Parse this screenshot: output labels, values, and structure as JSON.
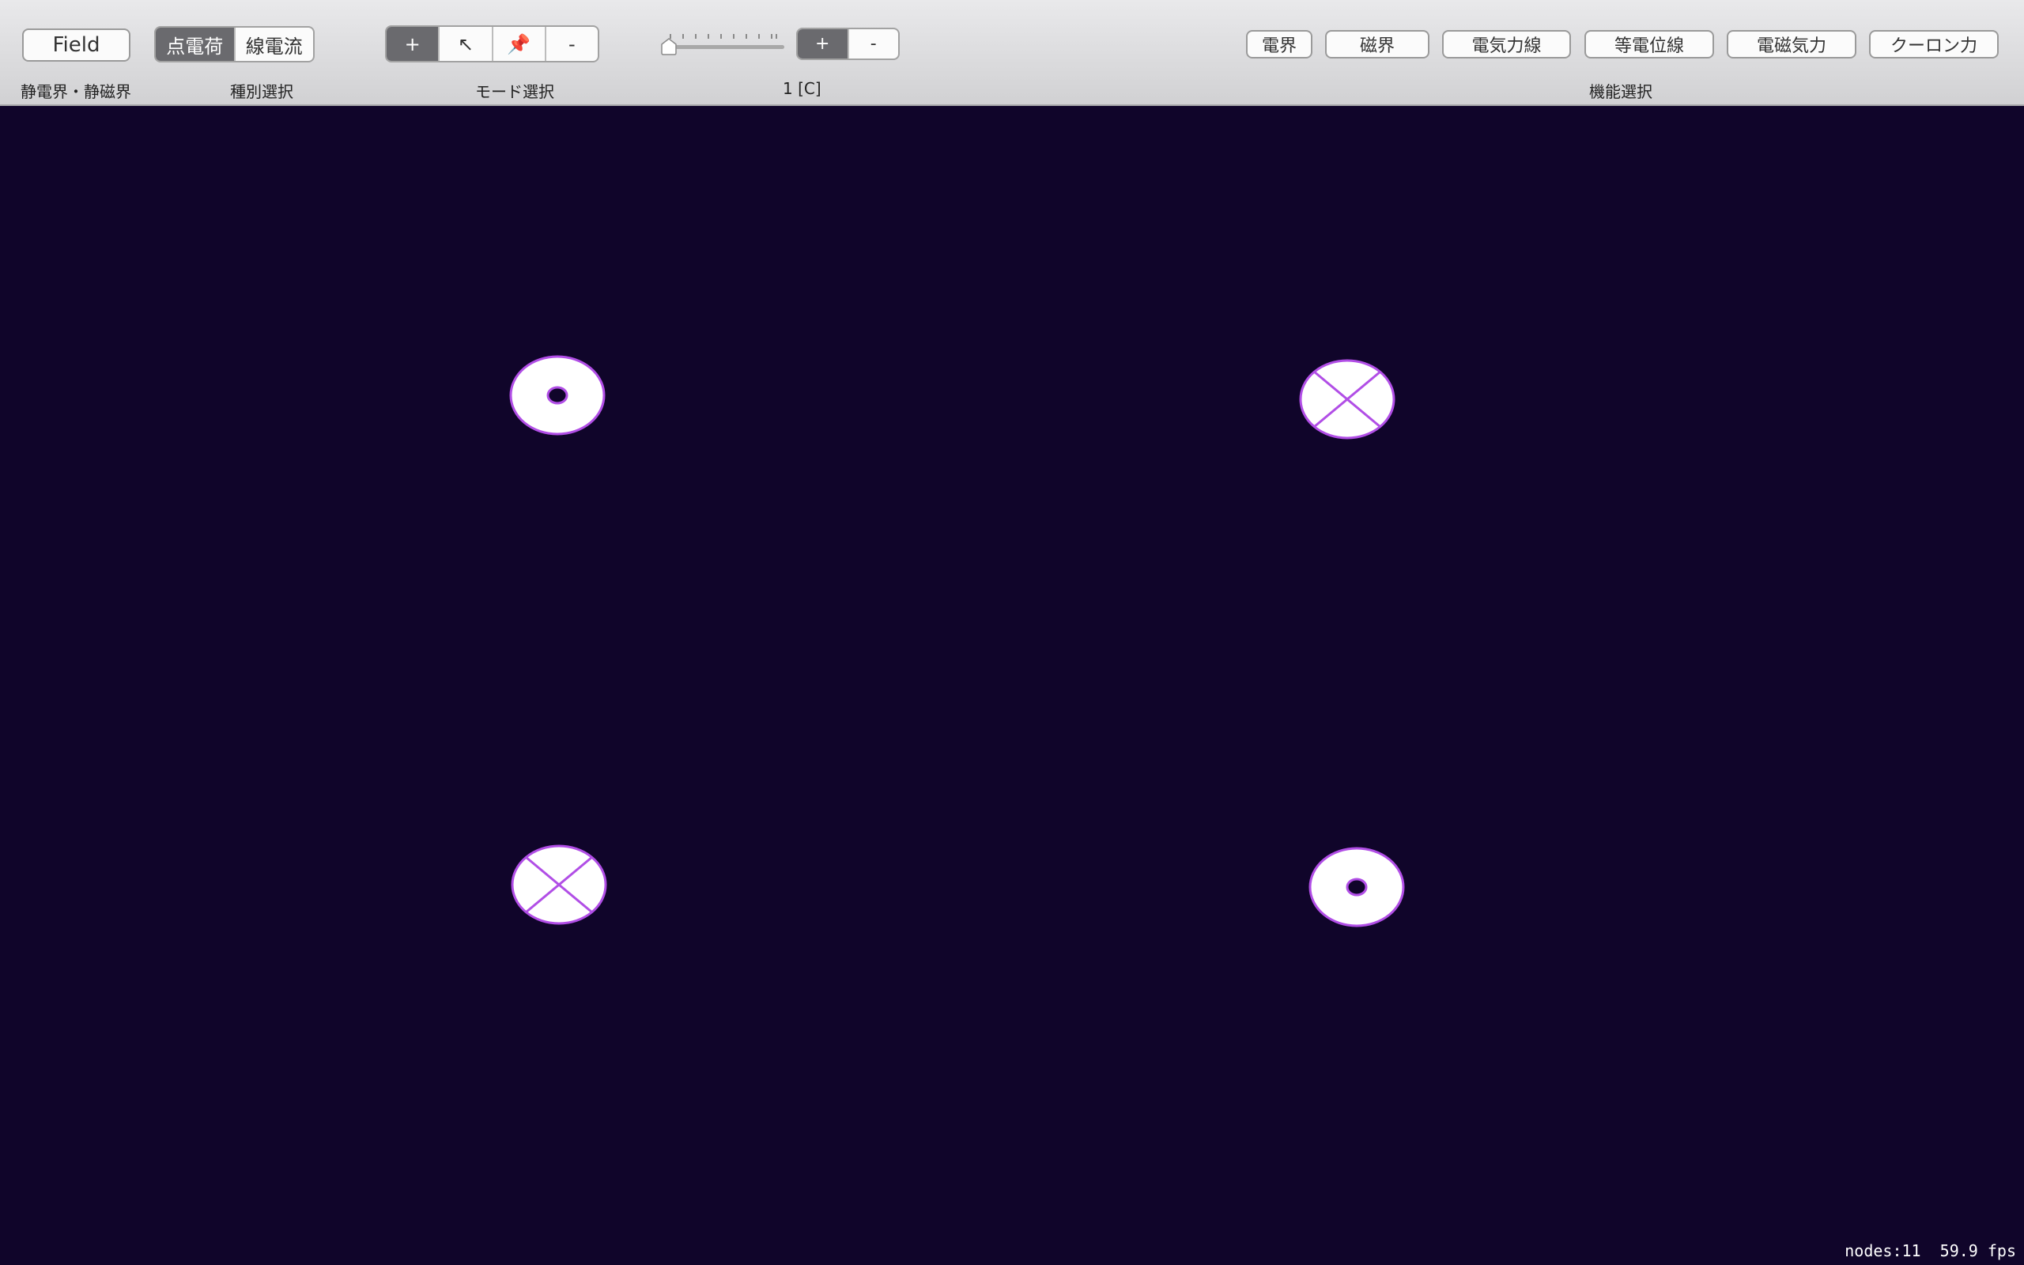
{
  "toolbar": {
    "field_button": "Field",
    "type_options": [
      "点電荷",
      "線電流"
    ],
    "type_selected": "点電荷",
    "mode_buttons": [
      "+",
      "↖",
      "📌",
      "-"
    ],
    "mode_selected": "+",
    "sign_buttons": [
      "+",
      "-"
    ],
    "sign_selected": "+",
    "slider_value": 1,
    "function_buttons": [
      "電界",
      "磁界",
      "電気力線",
      "等電位線",
      "電磁気力",
      "クーロン力"
    ],
    "labels": {
      "field": "静電界・静磁界",
      "type": "種別選択",
      "mode": "モード選択",
      "value": "1 [C]",
      "function": "機能選択"
    }
  },
  "canvas": {
    "background": "#10052a",
    "charges": [
      {
        "name": "out-of-page",
        "symbol": "dot"
      },
      {
        "name": "into-page",
        "symbol": "cross"
      },
      {
        "name": "into-page",
        "symbol": "cross"
      },
      {
        "name": "out-of-page",
        "symbol": "dot"
      }
    ],
    "stroke_color": "#b14ee6",
    "fill_color": "#ffffff"
  },
  "status": {
    "nodes": "nodes:11",
    "fps": "59.9 fps"
  }
}
